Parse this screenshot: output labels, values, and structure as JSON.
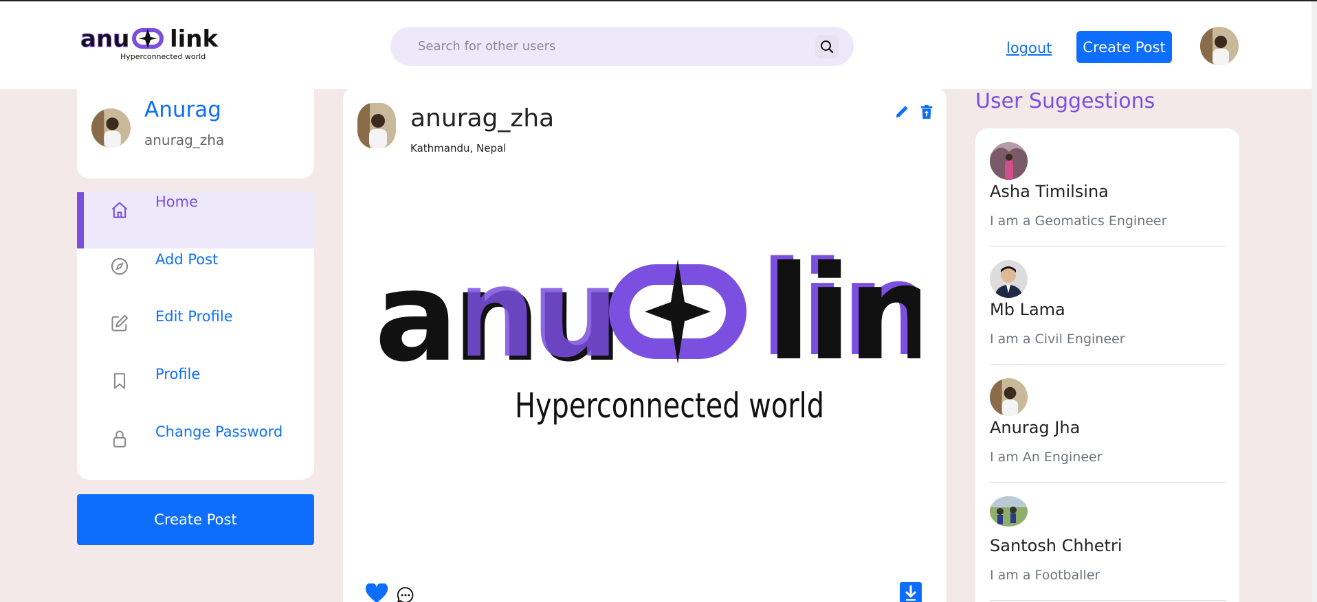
{
  "navbar": {
    "logo_text": "anu link",
    "logo_tagline": "Hyperconnected world",
    "search_placeholder": "Search for other users",
    "logout_label": "logout",
    "create_post_label": "Create Post"
  },
  "sidebar": {
    "profile": {
      "name": "Anurag",
      "username": "anurag_zha"
    },
    "menu": [
      {
        "label": "Home",
        "icon": "home-icon",
        "active": true
      },
      {
        "label": "Add Post",
        "icon": "compass-icon",
        "active": false
      },
      {
        "label": "Edit Profile",
        "icon": "edit-icon",
        "active": false
      },
      {
        "label": "Profile",
        "icon": "bookmark-icon",
        "active": false
      },
      {
        "label": "Change Password",
        "icon": "lock-icon",
        "active": false
      }
    ],
    "create_post_label": "Create Post"
  },
  "post": {
    "username": "anurag_zha",
    "location": "Kathmandu, Nepal",
    "image_logo_text": "anu link",
    "image_tagline": "Hyperconnected world"
  },
  "suggestions": {
    "title": "User Suggestions",
    "users": [
      {
        "name": "Asha Timilsina",
        "bio": "I am a Geomatics Engineer"
      },
      {
        "name": "Mb Lama",
        "bio": "I am a Civil Engineer"
      },
      {
        "name": "Anurag Jha",
        "bio": "I am An Engineer"
      },
      {
        "name": "Santosh Chhetri",
        "bio": "I am a Footballer"
      }
    ]
  },
  "colors": {
    "primary": "#0d6efd",
    "accent": "#7b4fe0",
    "background": "#f3e9e9"
  }
}
